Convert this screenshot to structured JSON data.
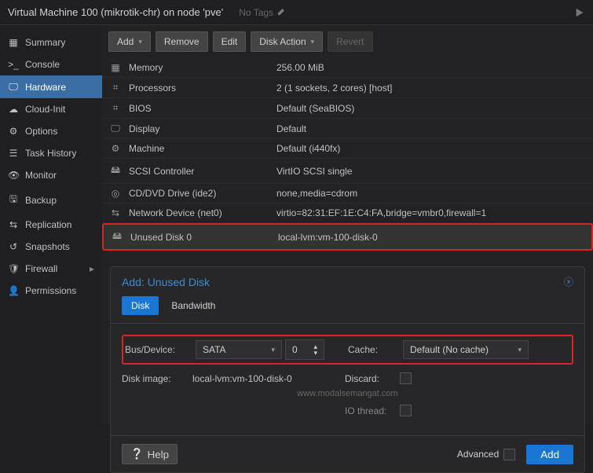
{
  "header": {
    "title": "Virtual Machine 100 (mikrotik-chr) on node 'pve'",
    "notags": "No Tags"
  },
  "sidebar": {
    "items": [
      {
        "label": "Summary"
      },
      {
        "label": "Console"
      },
      {
        "label": "Hardware"
      },
      {
        "label": "Cloud-Init"
      },
      {
        "label": "Options"
      },
      {
        "label": "Task History"
      },
      {
        "label": "Monitor"
      },
      {
        "label": "Backup"
      },
      {
        "label": "Replication"
      },
      {
        "label": "Snapshots"
      },
      {
        "label": "Firewall"
      },
      {
        "label": "Permissions"
      }
    ]
  },
  "toolbar": {
    "add": "Add",
    "remove": "Remove",
    "edit": "Edit",
    "diskaction": "Disk Action",
    "revert": "Revert"
  },
  "hw": {
    "rows": [
      {
        "name": "Memory",
        "val": "256.00 MiB"
      },
      {
        "name": "Processors",
        "val": "2 (1 sockets, 2 cores) [host]"
      },
      {
        "name": "BIOS",
        "val": "Default (SeaBIOS)"
      },
      {
        "name": "Display",
        "val": "Default"
      },
      {
        "name": "Machine",
        "val": "Default (i440fx)"
      },
      {
        "name": "SCSI Controller",
        "val": "VirtIO SCSI single"
      },
      {
        "name": "CD/DVD Drive (ide2)",
        "val": "none,media=cdrom"
      },
      {
        "name": "Network Device (net0)",
        "val": "virtio=82:31:EF:1E:C4:FA,bridge=vmbr0,firewall=1"
      },
      {
        "name": "Unused Disk 0",
        "val": "local-lvm:vm-100-disk-0"
      }
    ]
  },
  "dialog": {
    "title": "Add: Unused Disk",
    "tabs": {
      "disk": "Disk",
      "bandwidth": "Bandwidth"
    },
    "labels": {
      "busdevice": "Bus/Device:",
      "diskimage": "Disk image:",
      "cache": "Cache:",
      "discard": "Discard:",
      "iothread": "IO thread:"
    },
    "values": {
      "bus": "SATA",
      "devicenum": "0",
      "diskimage": "local-lvm:vm-100-disk-0",
      "cache": "Default (No cache)"
    },
    "watermark": "www.modalsemangat.com",
    "footer": {
      "help": "Help",
      "advanced": "Advanced",
      "add": "Add"
    }
  }
}
